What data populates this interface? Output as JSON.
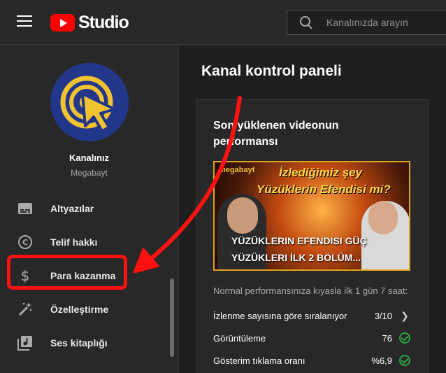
{
  "header": {
    "app_name": "Studio",
    "search_placeholder": "Kanalınızda arayın"
  },
  "sidebar": {
    "channel_name": "Kanalınız",
    "channel_handle": "Megabayt",
    "items": [
      {
        "label": "Altyazılar",
        "icon": "subtitles-icon"
      },
      {
        "label": "Telif hakkı",
        "icon": "copyright-icon"
      },
      {
        "label": "Para kazanma",
        "icon": "dollar-icon"
      },
      {
        "label": "Özelleştirme",
        "icon": "magic-wand-icon"
      },
      {
        "label": "Ses kitaplığı",
        "icon": "music-library-icon"
      }
    ]
  },
  "main": {
    "title": "Kanal kontrol paneli",
    "card": {
      "title": "Son yüklenen videonun performansı",
      "thumbnail": {
        "brand": "megabayt",
        "headline_1": "İzlediğimiz şey",
        "headline_2": "Yüzüklerin Efendisi mi?",
        "video_title": "YÜZÜKLERIN EFENDISI GÜÇ YÜZÜKLERI İLK 2 BÖLÜM..."
      },
      "subtitle": "Normal performansınıza kıyasla ilk 1 gün 7 saat:",
      "metrics": [
        {
          "label": "İzlenme sayısına göre sıralanıyor",
          "value": "3/10",
          "indicator": "chevron-right-icon"
        },
        {
          "label": "Görüntüleme",
          "value": "76",
          "indicator": "check-circle-icon"
        },
        {
          "label": "Gösterim tıklama oranı",
          "value": "%6,9",
          "indicator": "check-circle-icon"
        }
      ]
    }
  },
  "colors": {
    "accent_red": "#ff0000",
    "annotation_red": "#ff1111",
    "success_green": "#2ba640",
    "avatar_blue": "#23378a",
    "avatar_yellow": "#f2c331"
  }
}
